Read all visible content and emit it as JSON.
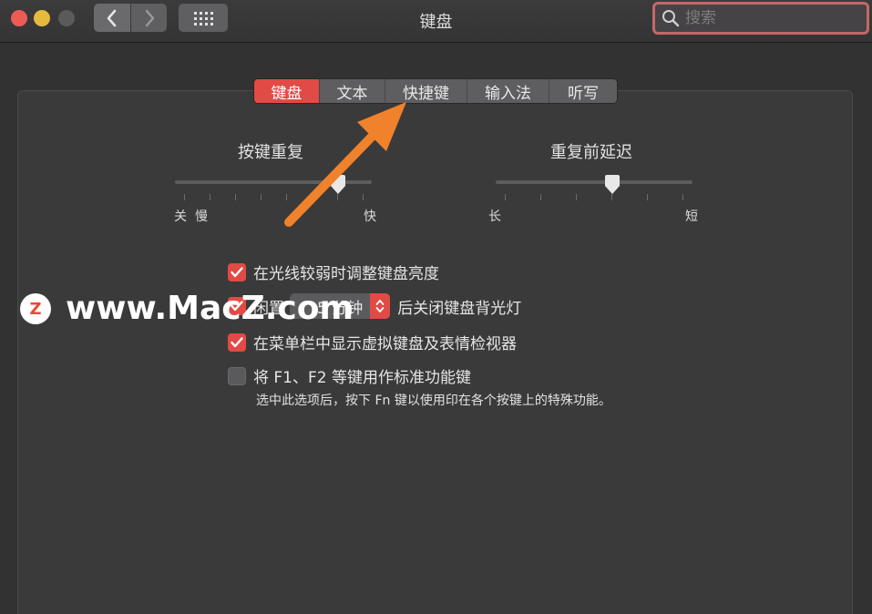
{
  "window": {
    "title": "键盘",
    "search_placeholder": "搜索"
  },
  "tabs": [
    {
      "label": "键盘",
      "active": true
    },
    {
      "label": "文本",
      "active": false
    },
    {
      "label": "快捷键",
      "active": false
    },
    {
      "label": "输入法",
      "active": false
    },
    {
      "label": "听写",
      "active": false
    }
  ],
  "key_repeat": {
    "title": "按键重复",
    "labels": [
      "关",
      "慢",
      "快"
    ],
    "value_fraction": 0.84
  },
  "delay_until_repeat": {
    "title": "重复前延迟",
    "labels": [
      "长",
      "短"
    ],
    "value_fraction": 0.6
  },
  "options": {
    "adjust_brightness": {
      "label": "在光线较弱时调整键盘亮度",
      "checked": true
    },
    "backlight_off": {
      "prefix": "闲置",
      "popup_value": "5 分钟",
      "suffix": "后关闭键盘背光灯",
      "checked": true
    },
    "show_viewer": {
      "label": "在菜单栏中显示虚拟键盘及表情检视器",
      "checked": true
    },
    "fn_keys": {
      "label": "将 F1、F2 等键用作标准功能键",
      "checked": false,
      "note": "选中此选项后，按下 Fn 键以使用印在各个按键上的特殊功能。"
    }
  },
  "watermark": {
    "text": "www.MacZ.com",
    "logo_letter": "Z"
  },
  "colors": {
    "accent": "#e24a45",
    "arrow": "#f0822c",
    "background": "#323232"
  }
}
